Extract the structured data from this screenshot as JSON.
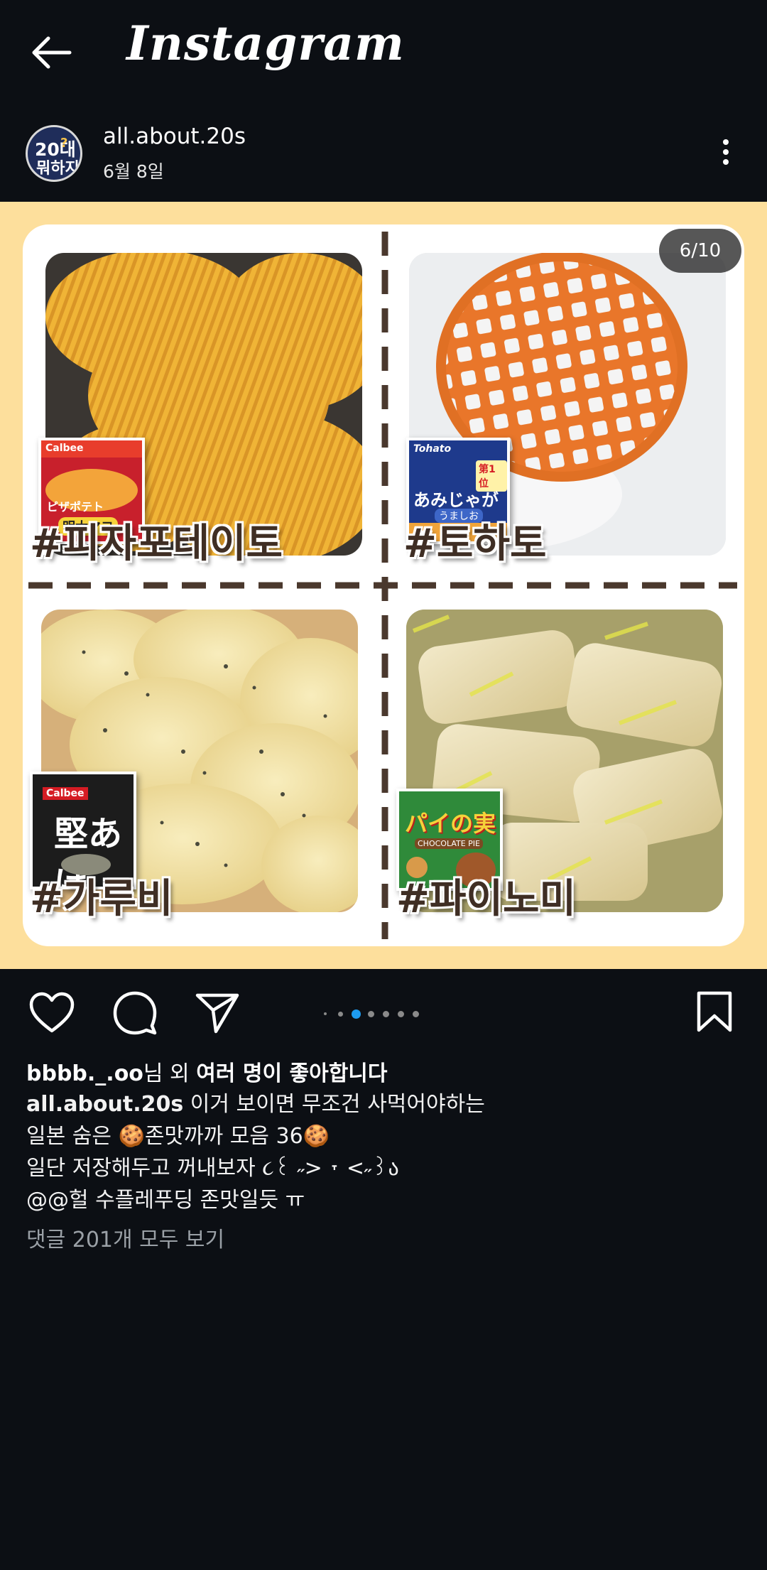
{
  "app": {
    "logo_text": "Instagram"
  },
  "post": {
    "username": "all.about.20s",
    "date": "6월 8일",
    "avatar": {
      "line1": "20대",
      "line2": "?",
      "line3": "뭐하지"
    },
    "carousel": {
      "counter": "6/10",
      "total": 10,
      "current": 6,
      "hashtags": [
        "#피자포테이토",
        "#토하토",
        "#가루비",
        "#파이노미"
      ],
      "package_texts": {
        "pizza_potato": [
          "Calbee",
          "ピザポテト",
          "明太マヨ"
        ],
        "tohato": [
          "Tohato",
          "あみじゃが",
          "うましお",
          "第1位"
        ],
        "calbee_pepper": [
          "Calbee",
          "堅あげ"
        ],
        "pie_no_mi": [
          "パイの実",
          "CHOCOLATE PIE"
        ]
      }
    },
    "likes": {
      "first_user": "bbbb._.oo",
      "suffix_1": "님 외 ",
      "suffix_bold": "여러 명이 좋아합니다"
    },
    "caption": {
      "user": "all.about.20s",
      "line1": " 이거 보이면 무조건 사먹어야하는",
      "line2": "일본 숨은 🍪존맛까까 모음 36🍪",
      "line3": "일단 저장해두고 꺼내보자 ૮꒰ ˶> ˕ <˶꒱ა",
      "line4": "@@헐 수플레푸딩 존맛일듯 ㅠ"
    },
    "view_comments": "댓글 201개 모두 보기"
  },
  "colors": {
    "background": "#0c0f14",
    "accent_dot": "#1d9bf0",
    "photo_bg": "#fddf9c",
    "hashtag": "#3f2e24"
  }
}
